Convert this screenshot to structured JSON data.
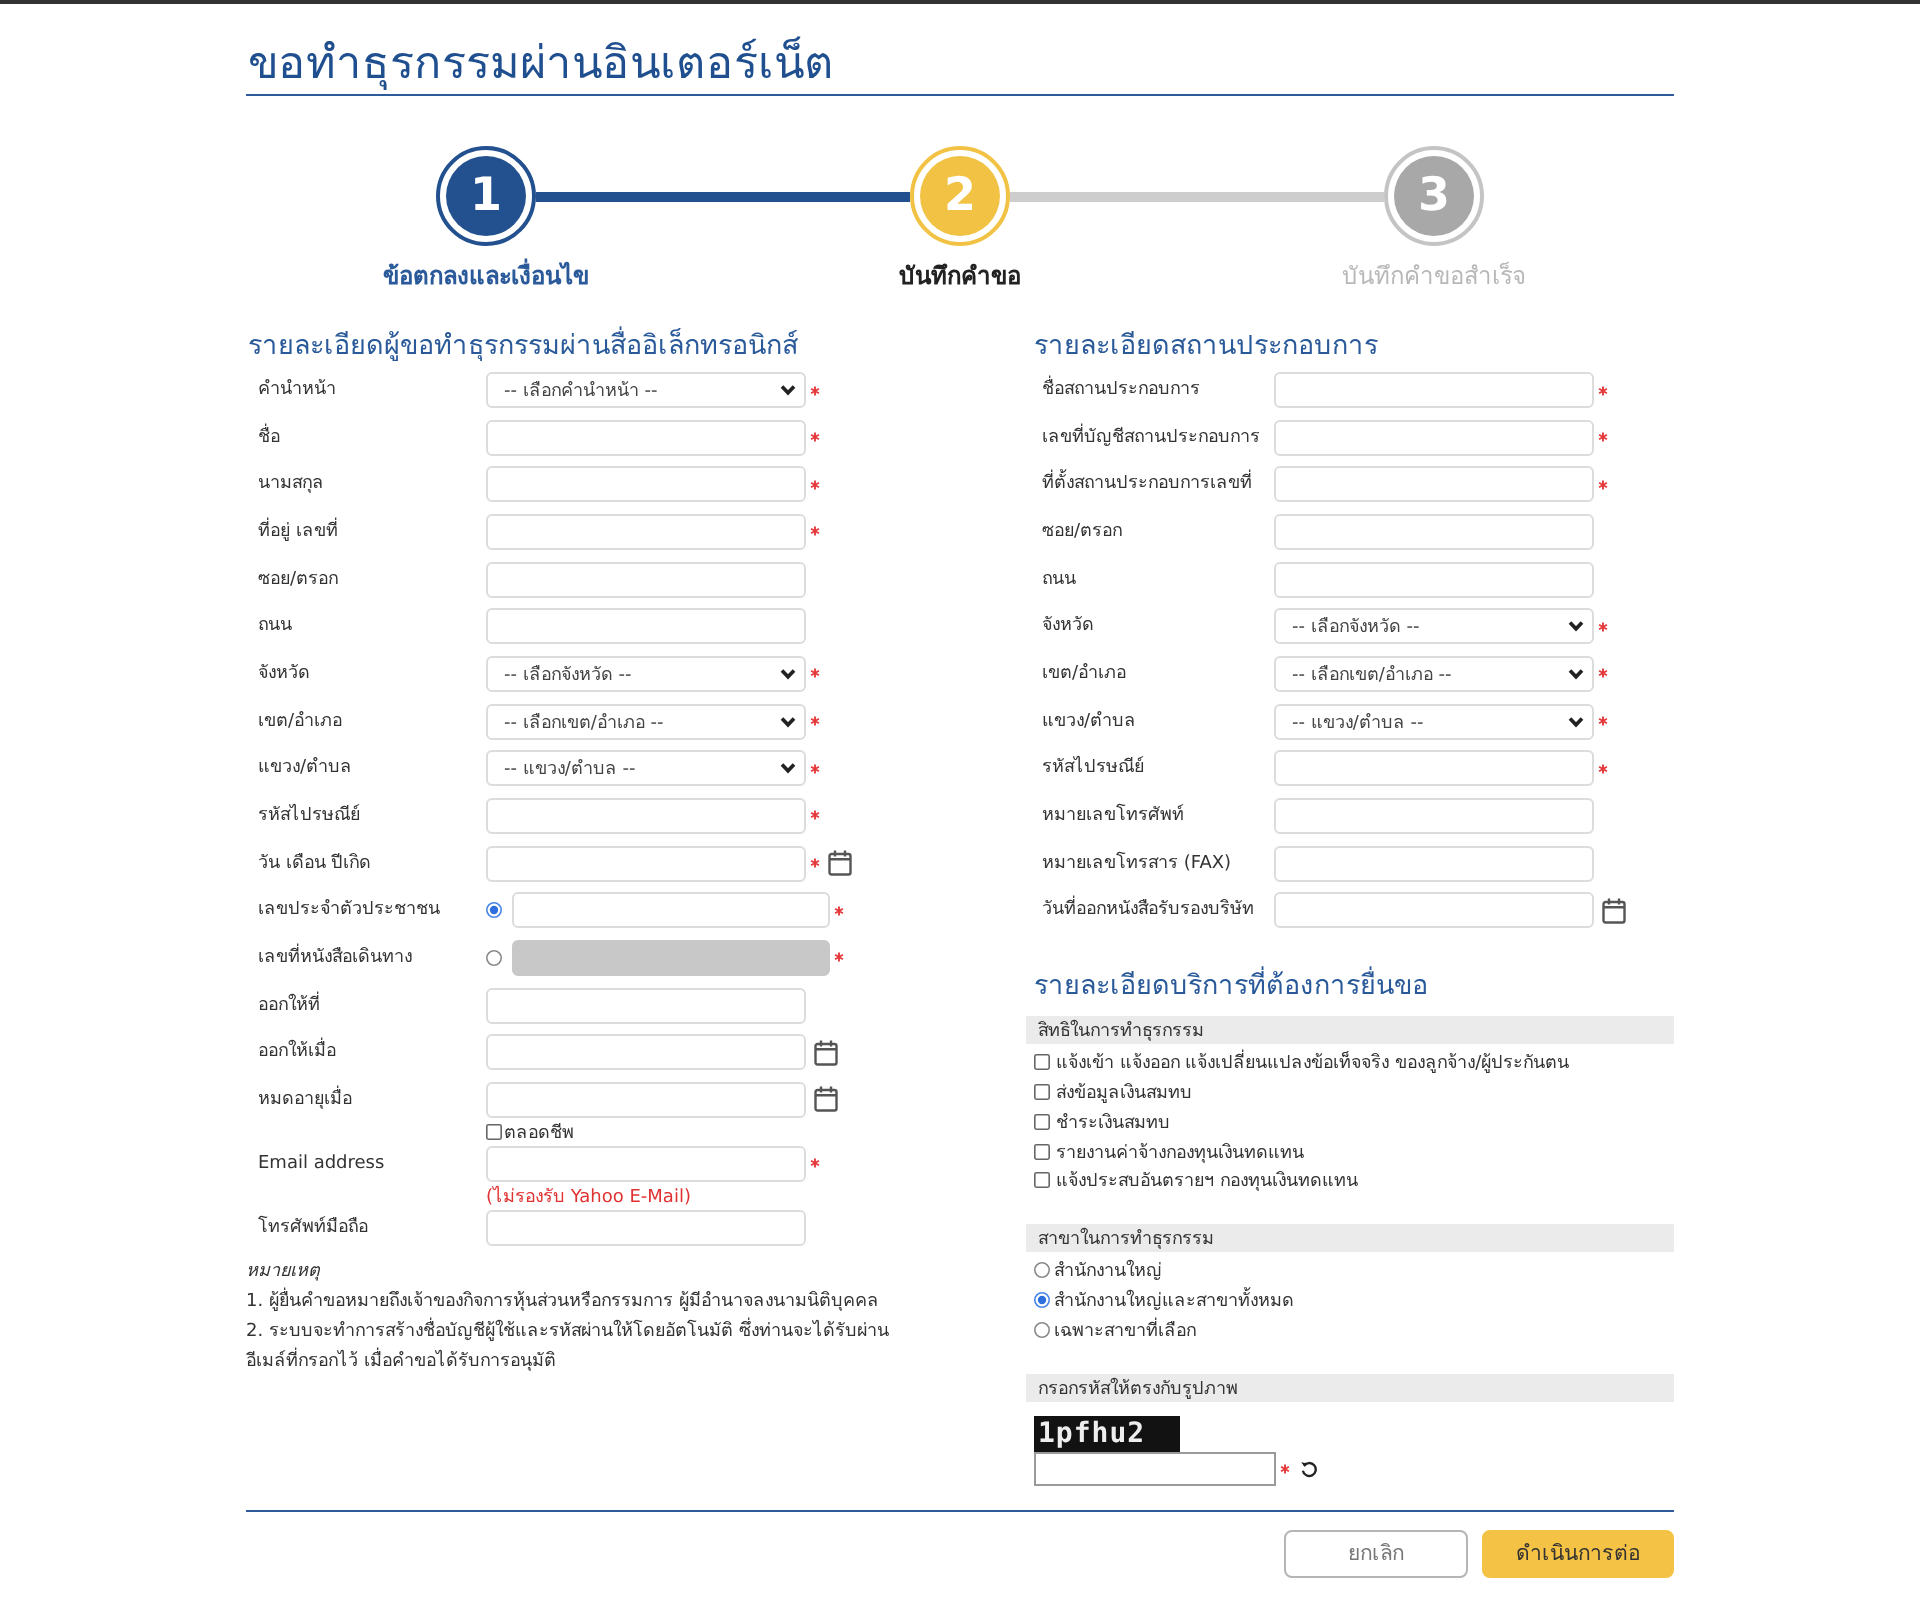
{
  "page": {
    "title": "ขอทำธุรกรรมผ่านอินเตอร์เน็ต"
  },
  "steps": [
    {
      "number": "1",
      "label": "ข้อตกลงและเงื่อนไข",
      "completed": true,
      "selected": false
    },
    {
      "number": "2",
      "label": "บันทึกคำขอ",
      "completed": false,
      "selected": true
    },
    {
      "number": "3",
      "label": "บันทึกคำขอสำเร็จ",
      "completed": false,
      "selected": false
    }
  ],
  "applicant": {
    "title": "รายละเอียดผู้ขอทำธุรกรรมผ่านสื่ออิเล็กทรอนิกส์",
    "fields": [
      {
        "kind": "select",
        "label": "คำนำหน้า",
        "value": "-- เลือกคำนำหน้า --",
        "required": true
      },
      {
        "kind": "text",
        "label": "ชื่อ",
        "required": true
      },
      {
        "kind": "text",
        "label": "นามสกุล",
        "required": true
      },
      {
        "kind": "text",
        "label": "ที่อยู่ เลขที่",
        "required": true
      },
      {
        "kind": "text",
        "label": "ซอย/ตรอก",
        "required": false
      },
      {
        "kind": "text",
        "label": "ถนน",
        "required": false
      },
      {
        "kind": "select",
        "label": "จังหวัด",
        "value": "-- เลือกจังหวัด --",
        "required": true
      },
      {
        "kind": "select",
        "label": "เขต/อำเภอ",
        "value": "-- เลือกเขต/อำเภอ --",
        "required": true
      },
      {
        "kind": "select",
        "label": "แขวง/ตำบล",
        "value": "-- แขวง/ตำบล --",
        "required": true
      },
      {
        "kind": "text",
        "label": "รหัสไปรษณีย์",
        "required": true
      },
      {
        "kind": "date",
        "label": "วัน เดือน ปีเกิด",
        "required": true
      },
      {
        "kind": "choice",
        "options": [
          {
            "label": "เลขประจำตัวประชาชน",
            "selected": true,
            "disabled": false,
            "required": true
          },
          {
            "label": "เลขที่หนังสือเดินทาง",
            "selected": false,
            "disabled": true,
            "required": true
          }
        ]
      },
      {
        "kind": "text",
        "label": "ออกให้ที่",
        "required": false
      },
      {
        "kind": "date",
        "label": "ออกให้เมื่อ",
        "required": false
      },
      {
        "kind": "date",
        "label": "หมดอายุเมื่อ",
        "required": false,
        "checkbox": {
          "label": "ตลอดชีพ",
          "checked": false
        }
      },
      {
        "kind": "text",
        "label": "Email address",
        "required": true,
        "note": "(ไม่รองรับ Yahoo E-Mail)"
      },
      {
        "kind": "text",
        "label": "โทรศัพท์มือถือ",
        "required": false
      }
    ]
  },
  "notes": {
    "title": "หมายเหตุ",
    "items": [
      "1. ผู้ยื่นคำขอหมายถึงเจ้าของกิจการหุ้นส่วนหรือกรรมการ ผู้มีอำนาจลงนามนิติบุคคล",
      "2. ระบบจะทำการสร้างชื่อบัญชีผู้ใช้และรหัสผ่านให้โดยอัตโนมัติ ซึ่งท่านจะได้รับผ่านอีเมล์ที่กรอกไว้ เมื่อคำขอได้รับการอนุมัติ"
    ]
  },
  "business": {
    "title": "รายละเอียดสถานประกอบการ",
    "fields": [
      {
        "kind": "text",
        "label": "ชื่อสถานประกอบการ",
        "required": true
      },
      {
        "kind": "text",
        "label": "เลขที่บัญชีสถานประกอบการ",
        "required": true
      },
      {
        "kind": "text",
        "label": "ที่ตั้งสถานประกอบการเลขที่",
        "required": true
      },
      {
        "kind": "text",
        "label": "ซอย/ตรอก",
        "required": false
      },
      {
        "kind": "text",
        "label": "ถนน",
        "required": false
      },
      {
        "kind": "select",
        "label": "จังหวัด",
        "value": "-- เลือกจังหวัด --",
        "required": true
      },
      {
        "kind": "select",
        "label": "เขต/อำเภอ",
        "value": "-- เลือกเขต/อำเภอ --",
        "required": true
      },
      {
        "kind": "select",
        "label": "แขวง/ตำบล",
        "value": "-- แขวง/ตำบล --",
        "required": true
      },
      {
        "kind": "text",
        "label": "รหัสไปรษณีย์",
        "required": true
      },
      {
        "kind": "text",
        "label": "หมายเลขโทรศัพท์",
        "required": false
      },
      {
        "kind": "text",
        "label": "หมายเลขโทรสาร (FAX)",
        "required": false
      },
      {
        "kind": "date",
        "label": "วันที่ออกหนังสือรับรองบริษัท",
        "required": false
      }
    ]
  },
  "services": {
    "title": "รายละเอียดบริการที่ต้องการยื่นขอ",
    "groups": [
      {
        "kind": "checkbox",
        "title": "สิทธิในการทำธุรกรรม",
        "options": [
          {
            "label": "แจ้งเข้า แจ้งออก แจ้งเปลี่ยนแปลงข้อเท็จจริง ของลูกจ้าง/ผู้ประกันตน",
            "checked": false
          },
          {
            "label": "ส่งข้อมูลเงินสมทบ",
            "checked": false
          },
          {
            "label": "ชำระเงินสมทบ",
            "checked": false
          },
          {
            "label": "รายงานค่าจ้างกองทุนเงินทดแทน",
            "checked": false
          },
          {
            "label": "แจ้งประสบอันตรายฯ กองทุนเงินทดแทน",
            "checked": false
          }
        ]
      },
      {
        "kind": "radio",
        "title": "สาขาในการทำธุรกรรม",
        "options": [
          {
            "label": "สำนักงานใหญ่",
            "selected": false
          },
          {
            "label": "สำนักงานใหญ่และสาขาทั้งหมด",
            "selected": true
          },
          {
            "label": "เฉพาะสาขาที่เลือก",
            "selected": false
          }
        ]
      },
      {
        "kind": "captcha",
        "title": "กรอกรหัสให้ตรงกับรูปภาพ",
        "code": "1pfhu2",
        "required": true
      }
    ]
  },
  "buttons": [
    {
      "label": "ยกเลิก",
      "kind": "secondary"
    },
    {
      "label": "ดำเนินการต่อ",
      "kind": "primary"
    }
  ]
}
